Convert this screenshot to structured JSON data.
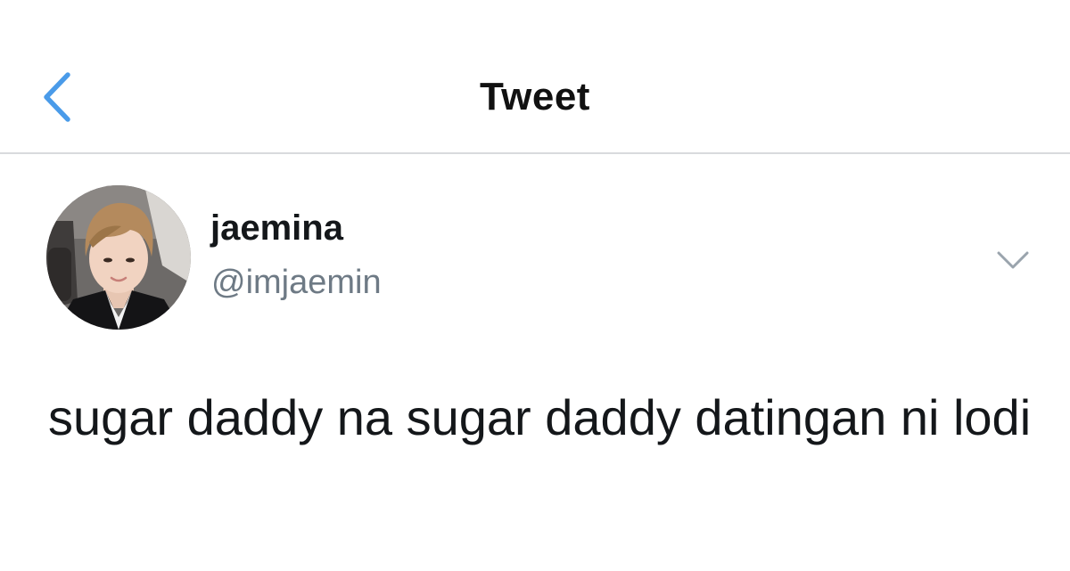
{
  "header": {
    "title": "Tweet",
    "back_icon": "chevron-left-icon",
    "accent_color": "#4a9be9"
  },
  "author": {
    "display_name": "jaemina",
    "handle": "@imjaemin",
    "avatar_icon": "profile-photo",
    "more_icon": "chevron-down-icon"
  },
  "tweet": {
    "text": "sugar daddy na sugar daddy datingan ni lodi"
  }
}
